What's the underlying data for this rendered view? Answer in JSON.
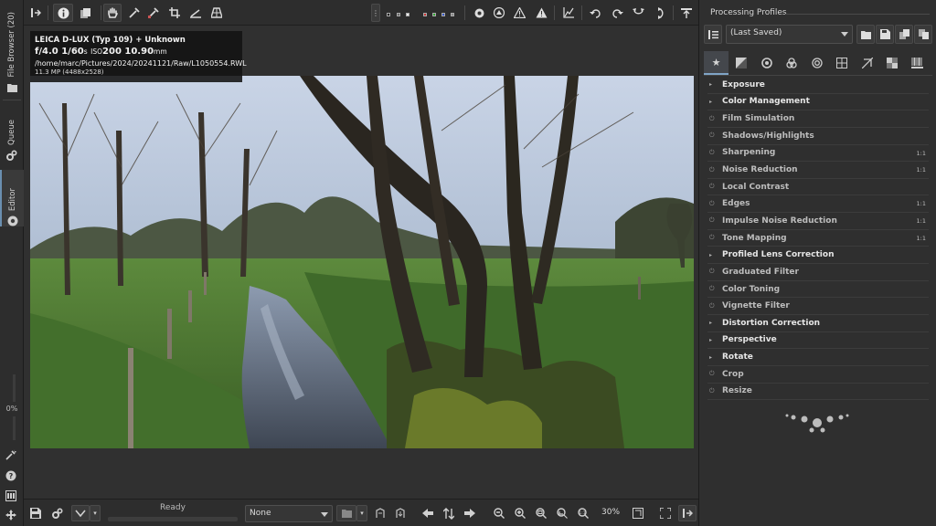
{
  "left_tabs": {
    "file_browser": "File Browser (20)",
    "queue": "Queue",
    "editor": "Editor",
    "percent": "0%"
  },
  "image_info": {
    "camera": "LEICA D-LUX (Typ 109) + Unknown",
    "aperture": "f/4.0",
    "shutter": "1/60",
    "shutter_unit": "s",
    "iso_label": "ISO",
    "iso": "200",
    "focal": "10.90",
    "focal_unit": "mm",
    "path": "/home/marc/Pictures/2024/20241121/Raw/L1050554.RWL",
    "size": "11.3 MP (4488x2528)"
  },
  "statusbar": {
    "status": "Ready",
    "profile_select": "None",
    "zoom": "30%"
  },
  "processing_profiles": {
    "title": "Processing Profiles",
    "selected": "(Last Saved)"
  },
  "tools": [
    {
      "name": "Exposure",
      "enabled": true,
      "collapsible": true
    },
    {
      "name": "Color Management",
      "enabled": true,
      "collapsible": true
    },
    {
      "name": "Film Simulation",
      "enabled": false,
      "collapsible": false
    },
    {
      "name": "Shadows/Highlights",
      "enabled": false,
      "collapsible": false
    },
    {
      "name": "Sharpening",
      "enabled": false,
      "collapsible": false,
      "badge": "1:1"
    },
    {
      "name": "Noise Reduction",
      "enabled": false,
      "collapsible": false,
      "badge": "1:1"
    },
    {
      "name": "Local Contrast",
      "enabled": false,
      "collapsible": false
    },
    {
      "name": "Edges",
      "enabled": false,
      "collapsible": false,
      "badge": "1:1"
    },
    {
      "name": "Impulse Noise Reduction",
      "enabled": false,
      "collapsible": false,
      "badge": "1:1"
    },
    {
      "name": "Tone Mapping",
      "enabled": false,
      "collapsible": false,
      "badge": "1:1"
    },
    {
      "name": "Profiled Lens Correction",
      "enabled": true,
      "collapsible": true
    },
    {
      "name": "Graduated Filter",
      "enabled": false,
      "collapsible": false
    },
    {
      "name": "Color Toning",
      "enabled": false,
      "collapsible": false
    },
    {
      "name": "Vignette Filter",
      "enabled": false,
      "collapsible": false
    },
    {
      "name": "Distortion Correction",
      "enabled": true,
      "collapsible": true
    },
    {
      "name": "Perspective",
      "enabled": true,
      "collapsible": true
    },
    {
      "name": "Rotate",
      "enabled": true,
      "collapsible": true
    },
    {
      "name": "Crop",
      "enabled": false,
      "collapsible": false
    },
    {
      "name": "Resize",
      "enabled": false,
      "collapsible": false
    }
  ],
  "colors": {
    "panel_bg": "#2f2f2f",
    "accent": "#7fa4c6",
    "sky": "#b8c7dc",
    "grass": "#4d7a34"
  }
}
